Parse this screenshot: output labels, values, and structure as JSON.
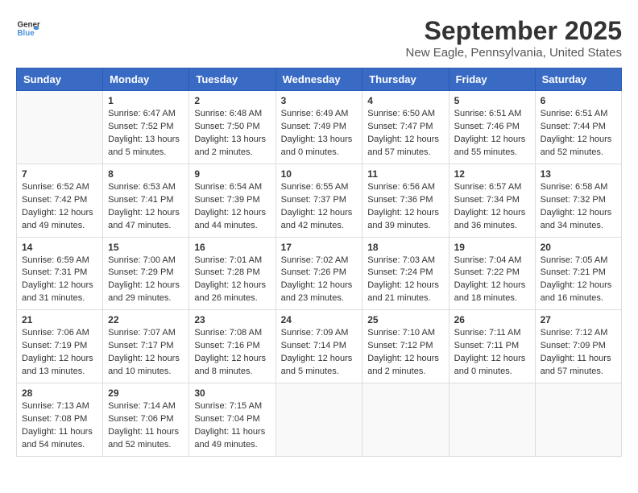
{
  "logo": {
    "general": "General",
    "blue": "Blue"
  },
  "title": "September 2025",
  "location": "New Eagle, Pennsylvania, United States",
  "headers": [
    "Sunday",
    "Monday",
    "Tuesday",
    "Wednesday",
    "Thursday",
    "Friday",
    "Saturday"
  ],
  "weeks": [
    [
      {
        "day": "",
        "content": ""
      },
      {
        "day": "1",
        "content": "Sunrise: 6:47 AM\nSunset: 7:52 PM\nDaylight: 13 hours\nand 5 minutes."
      },
      {
        "day": "2",
        "content": "Sunrise: 6:48 AM\nSunset: 7:50 PM\nDaylight: 13 hours\nand 2 minutes."
      },
      {
        "day": "3",
        "content": "Sunrise: 6:49 AM\nSunset: 7:49 PM\nDaylight: 13 hours\nand 0 minutes."
      },
      {
        "day": "4",
        "content": "Sunrise: 6:50 AM\nSunset: 7:47 PM\nDaylight: 12 hours\nand 57 minutes."
      },
      {
        "day": "5",
        "content": "Sunrise: 6:51 AM\nSunset: 7:46 PM\nDaylight: 12 hours\nand 55 minutes."
      },
      {
        "day": "6",
        "content": "Sunrise: 6:51 AM\nSunset: 7:44 PM\nDaylight: 12 hours\nand 52 minutes."
      }
    ],
    [
      {
        "day": "7",
        "content": "Sunrise: 6:52 AM\nSunset: 7:42 PM\nDaylight: 12 hours\nand 49 minutes."
      },
      {
        "day": "8",
        "content": "Sunrise: 6:53 AM\nSunset: 7:41 PM\nDaylight: 12 hours\nand 47 minutes."
      },
      {
        "day": "9",
        "content": "Sunrise: 6:54 AM\nSunset: 7:39 PM\nDaylight: 12 hours\nand 44 minutes."
      },
      {
        "day": "10",
        "content": "Sunrise: 6:55 AM\nSunset: 7:37 PM\nDaylight: 12 hours\nand 42 minutes."
      },
      {
        "day": "11",
        "content": "Sunrise: 6:56 AM\nSunset: 7:36 PM\nDaylight: 12 hours\nand 39 minutes."
      },
      {
        "day": "12",
        "content": "Sunrise: 6:57 AM\nSunset: 7:34 PM\nDaylight: 12 hours\nand 36 minutes."
      },
      {
        "day": "13",
        "content": "Sunrise: 6:58 AM\nSunset: 7:32 PM\nDaylight: 12 hours\nand 34 minutes."
      }
    ],
    [
      {
        "day": "14",
        "content": "Sunrise: 6:59 AM\nSunset: 7:31 PM\nDaylight: 12 hours\nand 31 minutes."
      },
      {
        "day": "15",
        "content": "Sunrise: 7:00 AM\nSunset: 7:29 PM\nDaylight: 12 hours\nand 29 minutes."
      },
      {
        "day": "16",
        "content": "Sunrise: 7:01 AM\nSunset: 7:28 PM\nDaylight: 12 hours\nand 26 minutes."
      },
      {
        "day": "17",
        "content": "Sunrise: 7:02 AM\nSunset: 7:26 PM\nDaylight: 12 hours\nand 23 minutes."
      },
      {
        "day": "18",
        "content": "Sunrise: 7:03 AM\nSunset: 7:24 PM\nDaylight: 12 hours\nand 21 minutes."
      },
      {
        "day": "19",
        "content": "Sunrise: 7:04 AM\nSunset: 7:22 PM\nDaylight: 12 hours\nand 18 minutes."
      },
      {
        "day": "20",
        "content": "Sunrise: 7:05 AM\nSunset: 7:21 PM\nDaylight: 12 hours\nand 16 minutes."
      }
    ],
    [
      {
        "day": "21",
        "content": "Sunrise: 7:06 AM\nSunset: 7:19 PM\nDaylight: 12 hours\nand 13 minutes."
      },
      {
        "day": "22",
        "content": "Sunrise: 7:07 AM\nSunset: 7:17 PM\nDaylight: 12 hours\nand 10 minutes."
      },
      {
        "day": "23",
        "content": "Sunrise: 7:08 AM\nSunset: 7:16 PM\nDaylight: 12 hours\nand 8 minutes."
      },
      {
        "day": "24",
        "content": "Sunrise: 7:09 AM\nSunset: 7:14 PM\nDaylight: 12 hours\nand 5 minutes."
      },
      {
        "day": "25",
        "content": "Sunrise: 7:10 AM\nSunset: 7:12 PM\nDaylight: 12 hours\nand 2 minutes."
      },
      {
        "day": "26",
        "content": "Sunrise: 7:11 AM\nSunset: 7:11 PM\nDaylight: 12 hours\nand 0 minutes."
      },
      {
        "day": "27",
        "content": "Sunrise: 7:12 AM\nSunset: 7:09 PM\nDaylight: 11 hours\nand 57 minutes."
      }
    ],
    [
      {
        "day": "28",
        "content": "Sunrise: 7:13 AM\nSunset: 7:08 PM\nDaylight: 11 hours\nand 54 minutes."
      },
      {
        "day": "29",
        "content": "Sunrise: 7:14 AM\nSunset: 7:06 PM\nDaylight: 11 hours\nand 52 minutes."
      },
      {
        "day": "30",
        "content": "Sunrise: 7:15 AM\nSunset: 7:04 PM\nDaylight: 11 hours\nand 49 minutes."
      },
      {
        "day": "",
        "content": ""
      },
      {
        "day": "",
        "content": ""
      },
      {
        "day": "",
        "content": ""
      },
      {
        "day": "",
        "content": ""
      }
    ]
  ]
}
